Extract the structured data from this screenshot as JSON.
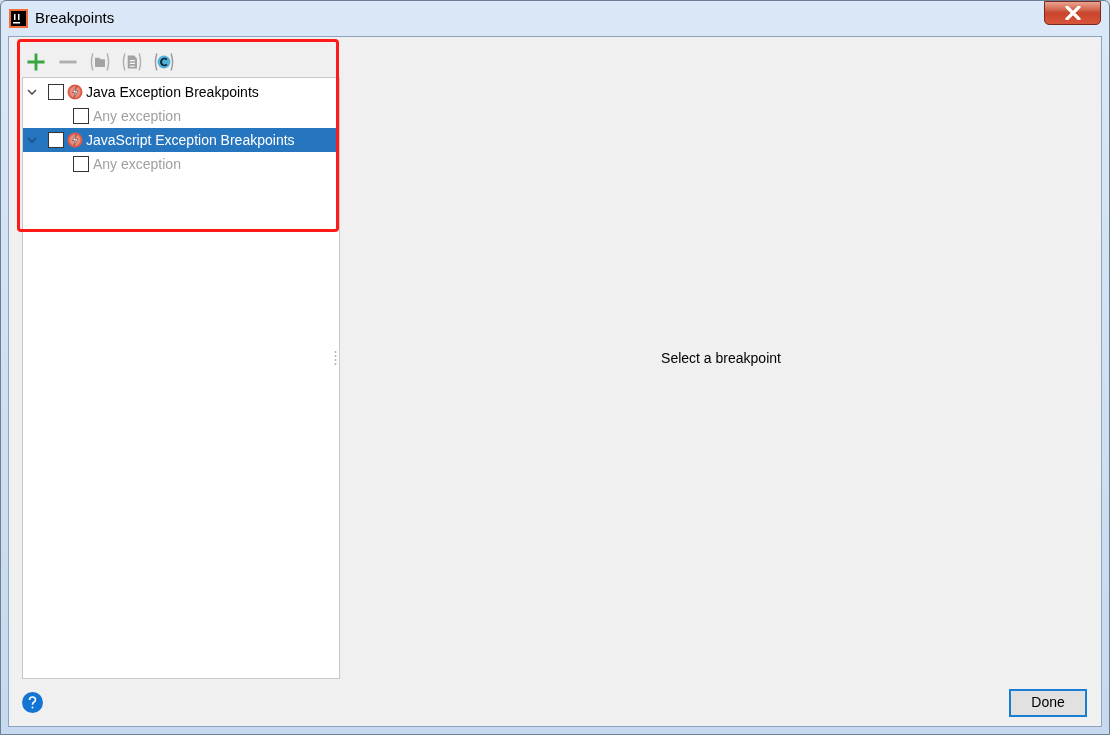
{
  "window": {
    "title": "Breakpoints"
  },
  "toolbar": [
    {
      "kind": "add",
      "disabled": false
    },
    {
      "kind": "remove",
      "disabled": true
    },
    {
      "kind": "group",
      "disabled": true
    },
    {
      "kind": "file",
      "disabled": true
    },
    {
      "kind": "class",
      "disabled": false
    }
  ],
  "tree": [
    {
      "label": "Java Exception Breakpoints",
      "expanded": true,
      "checked": false,
      "selected": false,
      "children": [
        {
          "label": "Any exception",
          "checked": false,
          "disabled": true,
          "selected": false
        }
      ]
    },
    {
      "label": "JavaScript Exception Breakpoints",
      "expanded": true,
      "checked": false,
      "selected": true,
      "children": [
        {
          "label": "Any exception",
          "checked": false,
          "disabled": true,
          "selected": false
        }
      ]
    }
  ],
  "details": {
    "placeholder_text": "Select a breakpoint"
  },
  "buttons": [
    {
      "label": "Done",
      "default": true
    }
  ],
  "annotations": [
    {
      "kind": "highlight-box"
    }
  ]
}
